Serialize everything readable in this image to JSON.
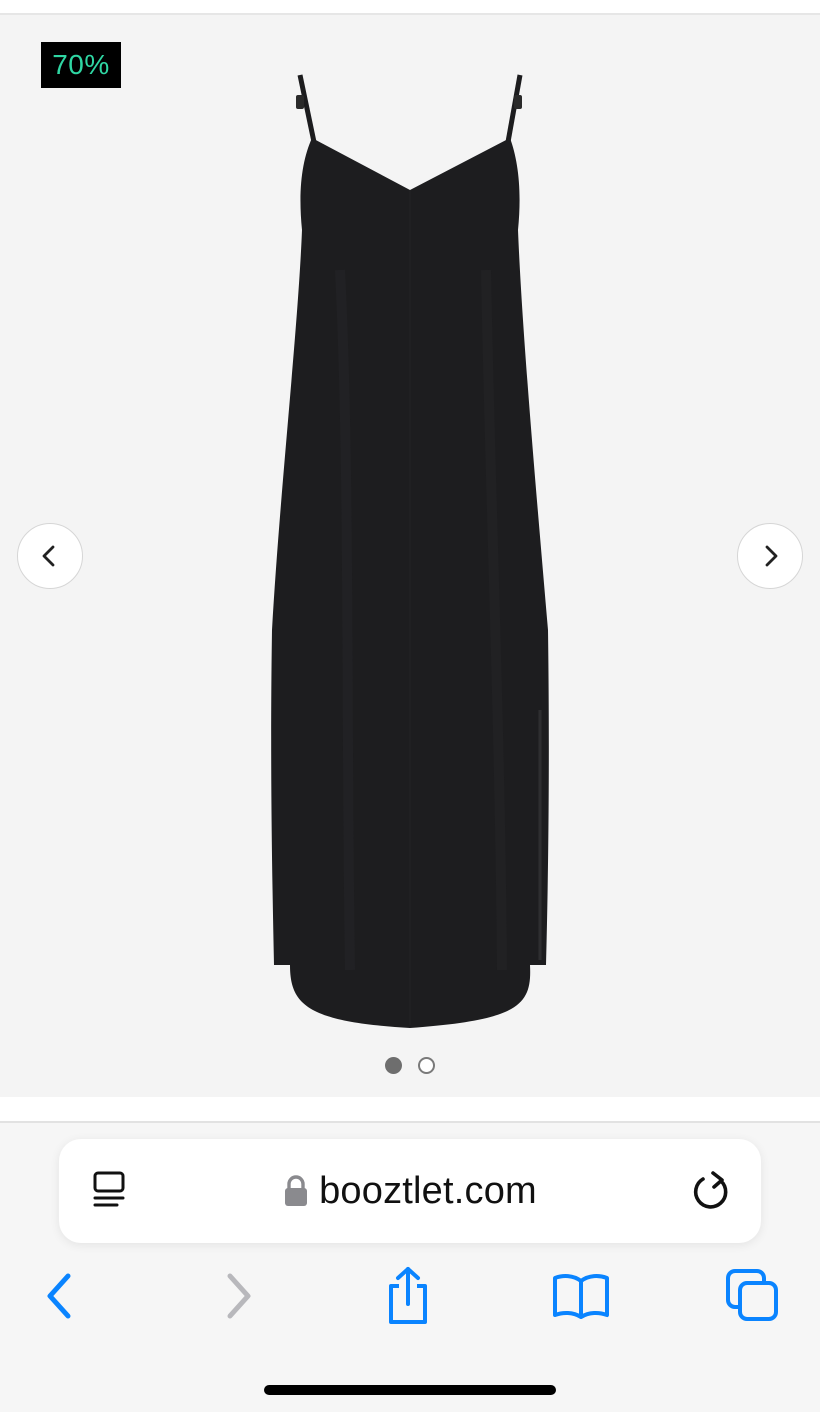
{
  "product": {
    "discount_badge": "70%",
    "image_alt": "Black satin slip dress with thin adjustable straps",
    "gallery": {
      "current_index": 1,
      "total": 2
    }
  },
  "browser": {
    "url": "booztlet.com",
    "secure": true
  },
  "icons": {
    "prev": "chevron-left-icon",
    "next": "chevron-right-icon",
    "reader": "reader-mode-icon",
    "lock": "lock-icon",
    "reload": "reload-icon",
    "back": "back-arrow-icon",
    "forward": "forward-arrow-icon",
    "share": "share-icon",
    "bookmarks": "bookmarks-icon",
    "tabs": "tabs-icon"
  },
  "colors": {
    "accent": "#0a84ff",
    "badge_bg": "#000000",
    "badge_text": "#2fd6a3",
    "gallery_bg": "#f4f4f4"
  }
}
